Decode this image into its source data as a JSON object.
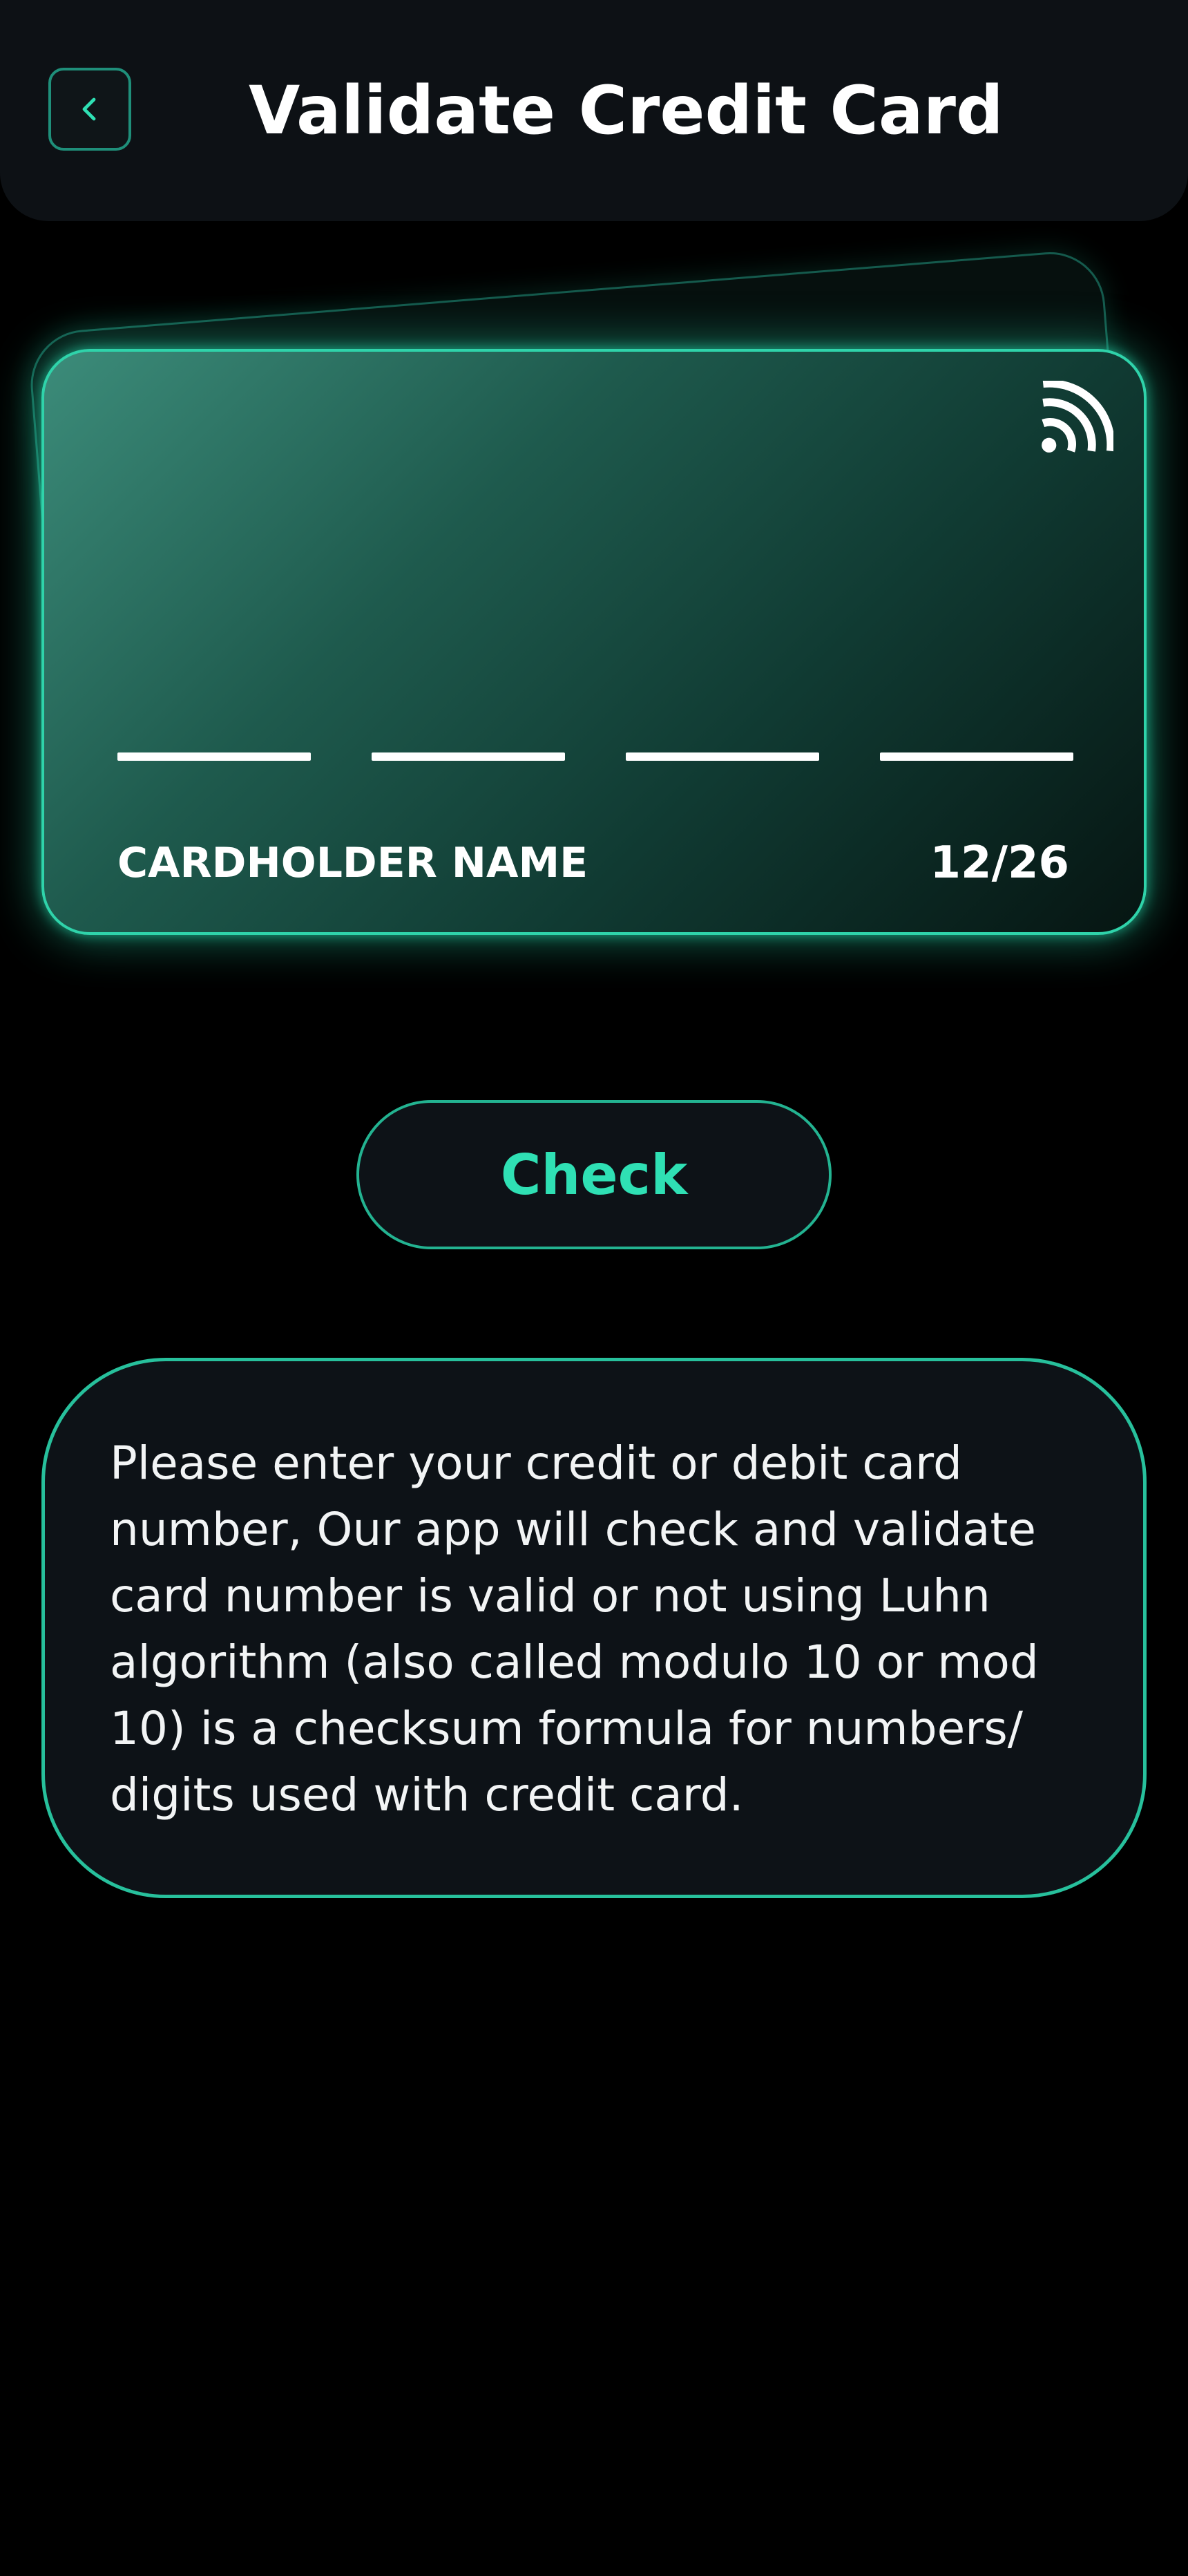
{
  "header": {
    "title": "Validate Credit Card",
    "back_icon": "chevron-left-icon"
  },
  "card": {
    "contactless_icon": "contactless-icon",
    "number_groups": [
      "",
      "",
      "",
      ""
    ],
    "cardholder_name": "CARDHOLDER NAME",
    "expiry": "12/26"
  },
  "actions": {
    "check_label": "Check"
  },
  "info": {
    "text": "Please enter your credit or debit card number, Our app will check and validate card number is valid or not using Luhn algorithm (also called modulo 10 or mod 10) is a checksum formula for numbers/ digits used with credit card."
  },
  "colors": {
    "background": "#000000",
    "header_bg": "#0d1115",
    "accent": "#2fe0b4",
    "panel_bg": "#0d1217"
  }
}
